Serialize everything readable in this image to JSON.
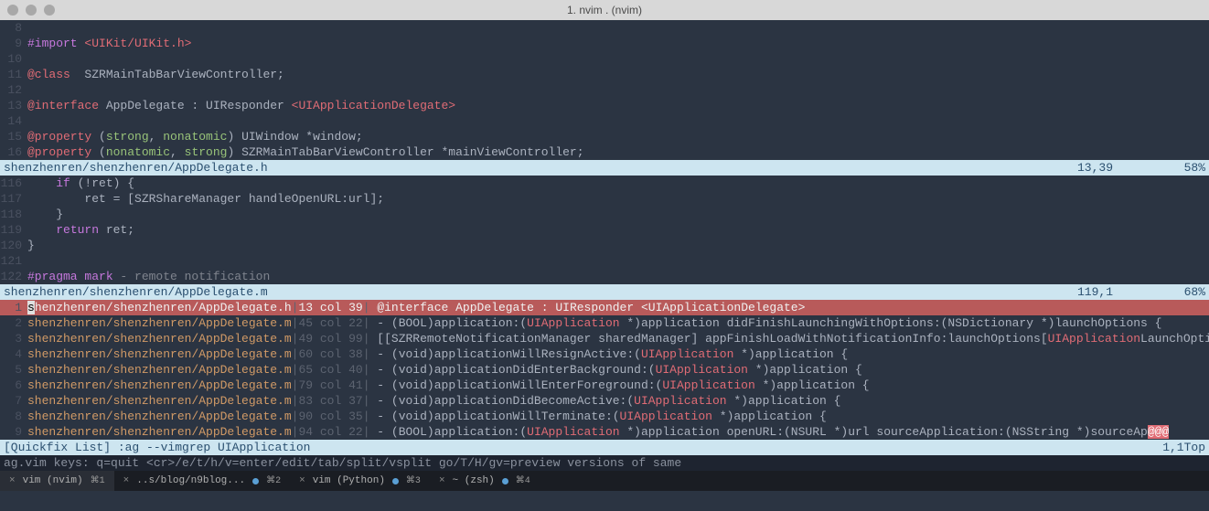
{
  "window": {
    "title": "1. nvim . (nvim)"
  },
  "panes": [
    {
      "status": {
        "path": "shenzhenren/shenzhenren/AppDelegate.h",
        "pos": "13,39",
        "pct": "58%"
      },
      "lines": [
        {
          "n": "8",
          "seg": [
            {
              "t": "",
              "c": ""
            }
          ]
        },
        {
          "n": "9",
          "seg": [
            {
              "t": "#import ",
              "c": "kw-purple"
            },
            {
              "t": "<UIKit/UIKit.h>",
              "c": "kw-red"
            }
          ]
        },
        {
          "n": "10",
          "seg": []
        },
        {
          "n": "11",
          "seg": [
            {
              "t": "@class",
              "c": "kw-red"
            },
            {
              "t": "  SZRMainTabBarViewController;",
              "c": ""
            }
          ]
        },
        {
          "n": "12",
          "seg": []
        },
        {
          "n": "13",
          "seg": [
            {
              "t": "@interface",
              "c": "kw-red"
            },
            {
              "t": " AppDelegate : UIResponder ",
              "c": ""
            },
            {
              "t": "<UIApplicationDelegate>",
              "c": "kw-red"
            }
          ]
        },
        {
          "n": "14",
          "seg": []
        },
        {
          "n": "15",
          "seg": [
            {
              "t": "@property",
              "c": "kw-red"
            },
            {
              "t": " (",
              "c": ""
            },
            {
              "t": "strong",
              "c": "kw-green"
            },
            {
              "t": ", ",
              "c": ""
            },
            {
              "t": "nonatomic",
              "c": "kw-green"
            },
            {
              "t": ") UIWindow *window;",
              "c": ""
            }
          ]
        },
        {
          "n": "16",
          "seg": [
            {
              "t": "@property",
              "c": "kw-red"
            },
            {
              "t": " (",
              "c": ""
            },
            {
              "t": "nonatomic",
              "c": "kw-green"
            },
            {
              "t": ", ",
              "c": ""
            },
            {
              "t": "strong",
              "c": "kw-green"
            },
            {
              "t": ") SZRMainTabBarViewController *mainViewController;",
              "c": ""
            }
          ]
        }
      ]
    },
    {
      "status": {
        "path": "shenzhenren/shenzhenren/AppDelegate.m",
        "pos": "119,1",
        "pct": "68%"
      },
      "lines": [
        {
          "n": "116",
          "seg": [
            {
              "t": "    ",
              "c": ""
            },
            {
              "t": "if",
              "c": "kw-purple"
            },
            {
              "t": " (!ret) {",
              "c": ""
            }
          ]
        },
        {
          "n": "117",
          "seg": [
            {
              "t": "        ret = [SZRShareManager handleOpenURL:url];",
              "c": ""
            }
          ]
        },
        {
          "n": "118",
          "seg": [
            {
              "t": "    }",
              "c": ""
            }
          ]
        },
        {
          "n": "119",
          "seg": [
            {
              "t": "    ",
              "c": ""
            },
            {
              "t": "return",
              "c": "kw-purple"
            },
            {
              "t": " ret;",
              "c": ""
            }
          ]
        },
        {
          "n": "120",
          "seg": [
            {
              "t": "}",
              "c": ""
            }
          ]
        },
        {
          "n": "121",
          "seg": []
        },
        {
          "n": "122",
          "seg": [
            {
              "t": "#pragma mark ",
              "c": "kw-purple"
            },
            {
              "t": "- remote notification",
              "c": "kw-gray"
            }
          ]
        }
      ]
    }
  ],
  "quickfix": {
    "status": {
      "label": "[Quickfix List] :ag --vimgrep UIApplication",
      "pos": "1,1",
      "pct": "Top"
    },
    "items": [
      {
        "n": "1",
        "selected": true,
        "cursor": "s",
        "path_rest": "henzhenren/shenzhenren/AppDelegate.h",
        "loc": "13 col 39",
        "code_pre": " @interface AppDelegate : UIResponder <",
        "hl": "UIApplication",
        "code_post": "Delegate>"
      },
      {
        "n": "2",
        "path": "shenzhenren/shenzhenren/AppDelegate.m",
        "loc": "45 col 22",
        "code_pre": " - (BOOL)application:(",
        "hl": "UIApplication",
        "code_post": " *)application didFinishLaunchingWithOptions:(NSDictionary *)launchOptions {"
      },
      {
        "n": "3",
        "path": "shenzhenren/shenzhenren/AppDelegate.m",
        "loc": "49 col 99",
        "code_pre": " [[SZRRemoteNotificationManager sharedManager] appFinishLoadWithNotificationInfo:launchOptions[",
        "hl": "UIApplication",
        "code_post": "LaunchOptionsRemoteNotificationKey]];",
        "wrap": true
      },
      {
        "n": "4",
        "path": "shenzhenren/shenzhenren/AppDelegate.m",
        "loc": "60 col 38",
        "code_pre": " - (void)applicationWillResignActive:(",
        "hl": "UIApplication",
        "code_post": " *)application {"
      },
      {
        "n": "5",
        "path": "shenzhenren/shenzhenren/AppDelegate.m",
        "loc": "65 col 40",
        "code_pre": " - (void)applicationDidEnterBackground:(",
        "hl": "UIApplication",
        "code_post": " *)application {"
      },
      {
        "n": "6",
        "path": "shenzhenren/shenzhenren/AppDelegate.m",
        "loc": "79 col 41",
        "code_pre": " - (void)applicationWillEnterForeground:(",
        "hl": "UIApplication",
        "code_post": " *)application {"
      },
      {
        "n": "7",
        "path": "shenzhenren/shenzhenren/AppDelegate.m",
        "loc": "83 col 37",
        "code_pre": " - (void)applicationDidBecomeActive:(",
        "hl": "UIApplication",
        "code_post": " *)application {"
      },
      {
        "n": "8",
        "path": "shenzhenren/shenzhenren/AppDelegate.m",
        "loc": "90 col 35",
        "code_pre": " - (void)applicationWillTerminate:(",
        "hl": "UIApplication",
        "code_post": " *)application {"
      },
      {
        "n": "9",
        "path": "shenzhenren/shenzhenren/AppDelegate.m",
        "loc": "94 col 22",
        "code_pre": " - (BOOL)application:(",
        "hl": "UIApplication",
        "code_post": " *)application openURL:(NSURL *)url sourceApplication:(NSString *)sourceAp",
        "err": "@@@"
      }
    ]
  },
  "helpline": "ag.vim keys: q=quit <cr>/e/t/h/v=enter/edit/tab/split/vsplit go/T/H/gv=preview versions of same",
  "tabs": [
    {
      "label": "vim (nvim)",
      "key": "⌘1",
      "active": true
    },
    {
      "label": "..s/blog/n9blog...",
      "key": "⌘2",
      "dot": true
    },
    {
      "label": "vim (Python)",
      "key": "⌘3",
      "dot": true
    },
    {
      "label": "~ (zsh)",
      "key": "⌘4",
      "dot": true
    }
  ]
}
